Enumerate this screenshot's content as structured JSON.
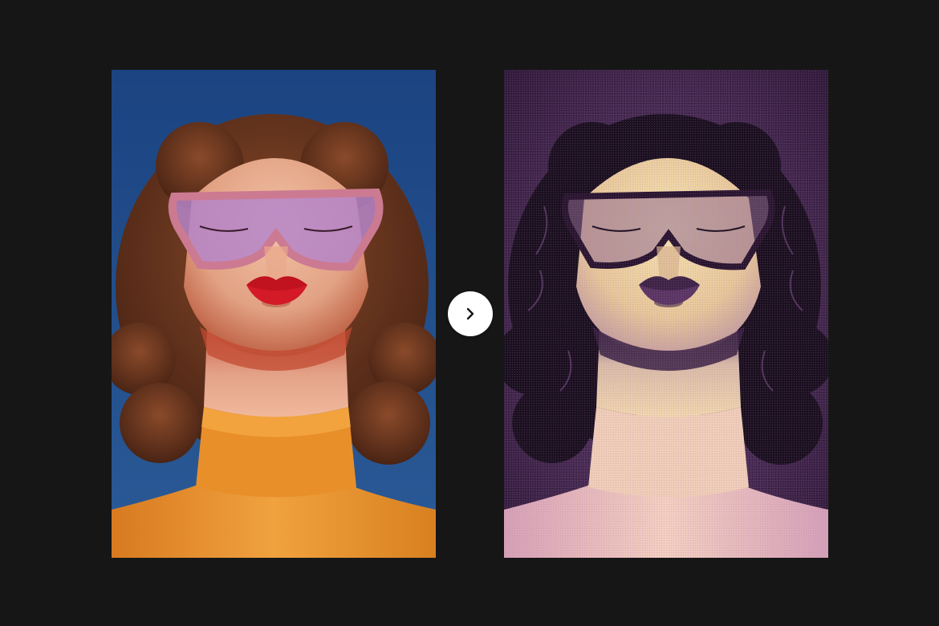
{
  "images": {
    "before": {
      "name": "original-photo",
      "colors": {
        "sky": "#1f4d86",
        "hair": "#6d3a22",
        "skin": "#e9ad8f",
        "shadow": "#c25a3a",
        "lips": "#c0121f",
        "glasses": "#b786c8",
        "frame": "#c9788f",
        "turtleneck": "#e6912f"
      }
    },
    "after": {
      "name": "halftone-effect-photo",
      "colors": {
        "bg": "#4a2a55",
        "dark": "#1e1124",
        "hair": "#1a1120",
        "skin": "#f0d9a2",
        "skin_pink": "#e2b0c0",
        "lips": "#4a2a55",
        "glasses": "#3a2144",
        "turtleneck": "#f2c9c8"
      }
    }
  },
  "arrow": {
    "icon": "chevron-right-icon",
    "color": "#161616"
  }
}
